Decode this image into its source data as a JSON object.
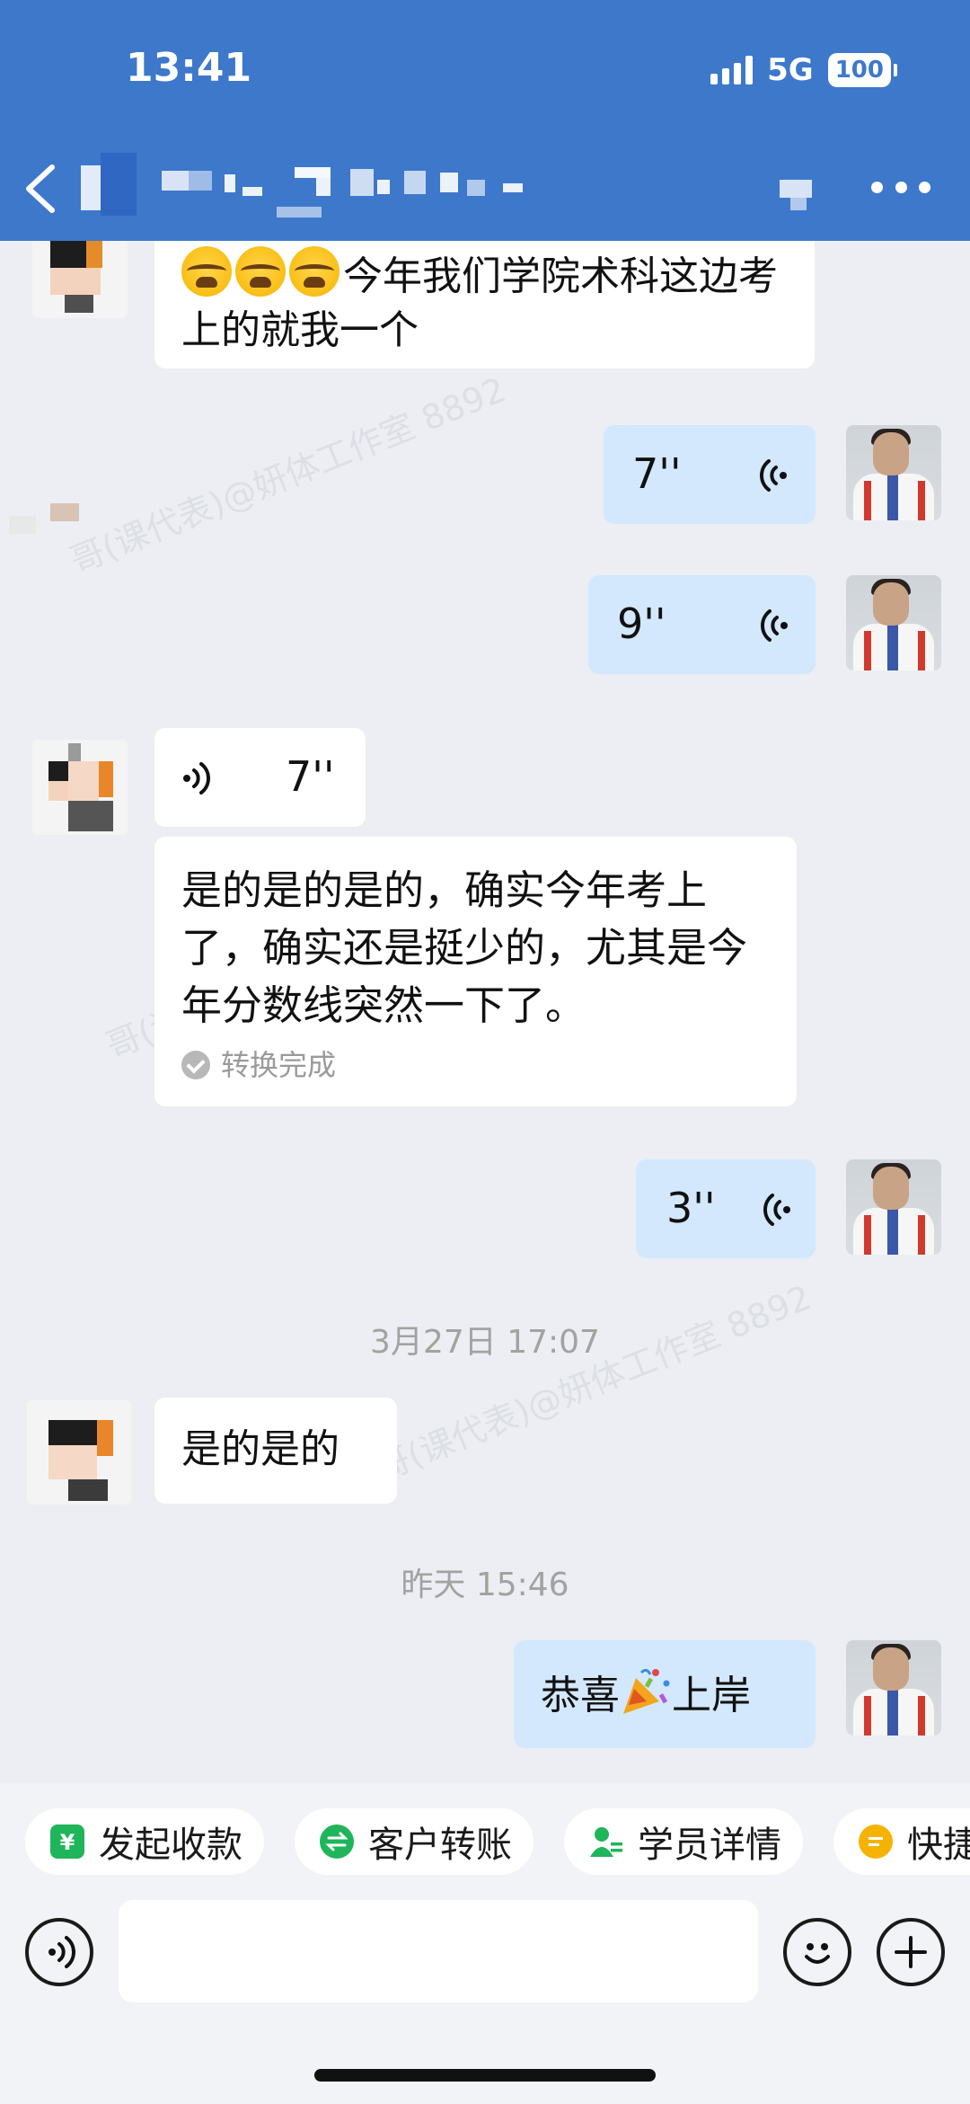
{
  "status": {
    "time": "13:41",
    "network": "5G",
    "battery": "100"
  },
  "header": {
    "title_obscured": true
  },
  "watermark": "哥(课代表)@妍体工作室 8892",
  "messages": [
    {
      "side": "in",
      "type": "text",
      "emoji_prefix": [
        "loudly-crying",
        "loudly-crying",
        "loudly-crying"
      ],
      "text": "今年我们学院术科这边考上的就我一个"
    },
    {
      "side": "out",
      "type": "voice",
      "duration": "7''"
    },
    {
      "side": "out",
      "type": "voice",
      "duration": "9''"
    },
    {
      "side": "in",
      "type": "voice",
      "duration": "7''",
      "transcript": "是的是的是的，确实今年考上了，确实还是挺少的，尤其是今年分数线突然一下了。",
      "transcript_status": "转换完成"
    },
    {
      "side": "out",
      "type": "voice",
      "duration": "3''"
    },
    {
      "type": "time",
      "text": "3月27日 17:07"
    },
    {
      "side": "in",
      "type": "text",
      "text": "是的是的"
    },
    {
      "type": "time",
      "text": "昨天 15:46"
    },
    {
      "side": "out",
      "type": "text",
      "text_before": "恭喜",
      "emoji": "party-popper",
      "text_after": "上岸"
    }
  ],
  "quick_actions": [
    {
      "label": "发起收款",
      "icon": "payment-icon",
      "color": "#1fb55a"
    },
    {
      "label": "客户转账",
      "icon": "transfer-icon",
      "color": "#1fb55a"
    },
    {
      "label": "学员详情",
      "icon": "student-icon",
      "color": "#1fb55a"
    },
    {
      "label": "快捷",
      "icon": "quick-reply-icon",
      "color": "#f5b300"
    }
  ],
  "input": {
    "value": "",
    "placeholder": ""
  }
}
